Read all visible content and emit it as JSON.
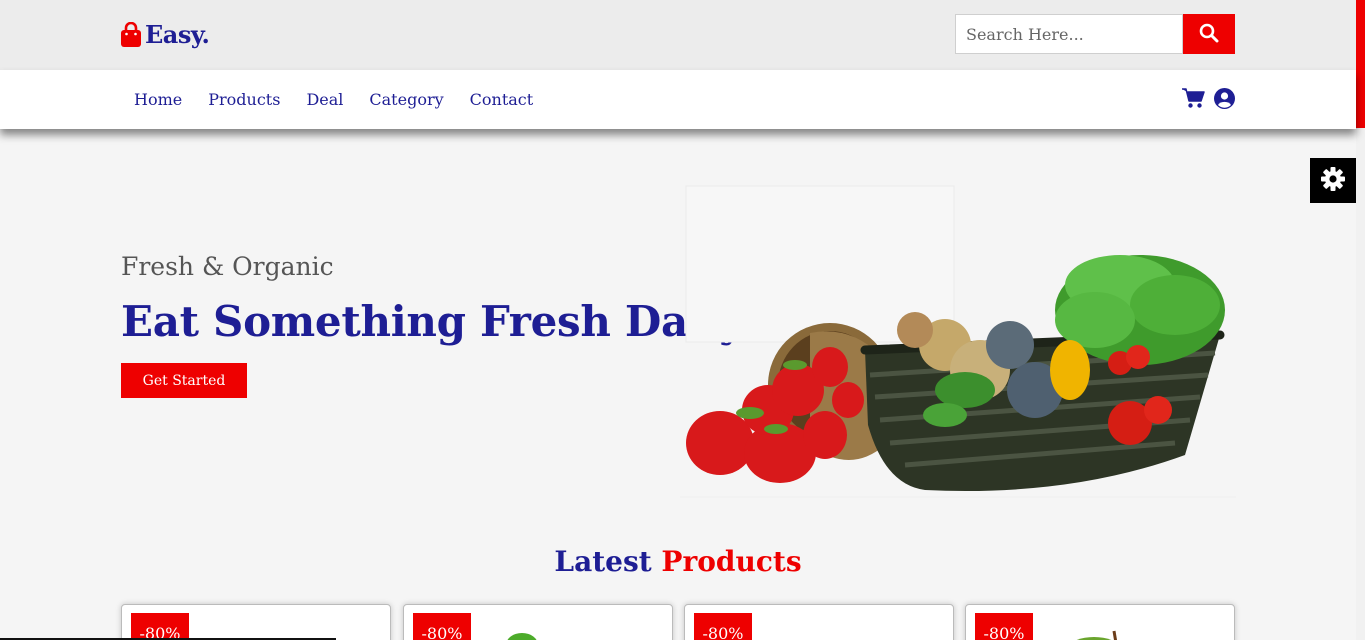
{
  "brand": {
    "name": "Easy.",
    "icon": "shopping-bag-icon",
    "icon_color": "#ee0000",
    "text_color": "#1e1e94"
  },
  "search": {
    "placeholder": "Search Here...",
    "button_icon": "search-icon"
  },
  "nav": {
    "links": [
      "Home",
      "Products",
      "Deal",
      "Category",
      "Contact"
    ],
    "icons": [
      "cart-icon",
      "user-circle-icon"
    ]
  },
  "settings": {
    "icon": "gear-icon"
  },
  "hero": {
    "subtitle": "Fresh & Organic",
    "title": "Eat Something Fresh Daily",
    "button": "Get Started",
    "image": "vegetable-basket-image"
  },
  "latest": {
    "title_part1": "Latest",
    "title_part2": "Products"
  },
  "products": [
    {
      "badge": "-80%"
    },
    {
      "badge": "-80%"
    },
    {
      "badge": "-80%"
    },
    {
      "badge": "-80%"
    }
  ],
  "colors": {
    "accent": "#ee0000",
    "brand": "#1e1e94",
    "background": "#f5f5f5"
  }
}
